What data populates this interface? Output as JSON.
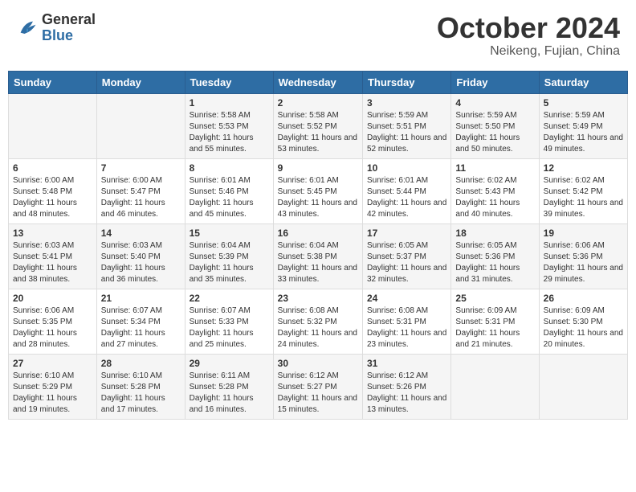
{
  "header": {
    "logo": {
      "general": "General",
      "blue": "Blue"
    },
    "title": "October 2024",
    "location": "Neikeng, Fujian, China"
  },
  "weekdays": [
    "Sunday",
    "Monday",
    "Tuesday",
    "Wednesday",
    "Thursday",
    "Friday",
    "Saturday"
  ],
  "weeks": [
    [
      {
        "day": "",
        "sunrise": "",
        "sunset": "",
        "daylight": ""
      },
      {
        "day": "",
        "sunrise": "",
        "sunset": "",
        "daylight": ""
      },
      {
        "day": "1",
        "sunrise": "Sunrise: 5:58 AM",
        "sunset": "Sunset: 5:53 PM",
        "daylight": "Daylight: 11 hours and 55 minutes."
      },
      {
        "day": "2",
        "sunrise": "Sunrise: 5:58 AM",
        "sunset": "Sunset: 5:52 PM",
        "daylight": "Daylight: 11 hours and 53 minutes."
      },
      {
        "day": "3",
        "sunrise": "Sunrise: 5:59 AM",
        "sunset": "Sunset: 5:51 PM",
        "daylight": "Daylight: 11 hours and 52 minutes."
      },
      {
        "day": "4",
        "sunrise": "Sunrise: 5:59 AM",
        "sunset": "Sunset: 5:50 PM",
        "daylight": "Daylight: 11 hours and 50 minutes."
      },
      {
        "day": "5",
        "sunrise": "Sunrise: 5:59 AM",
        "sunset": "Sunset: 5:49 PM",
        "daylight": "Daylight: 11 hours and 49 minutes."
      }
    ],
    [
      {
        "day": "6",
        "sunrise": "Sunrise: 6:00 AM",
        "sunset": "Sunset: 5:48 PM",
        "daylight": "Daylight: 11 hours and 48 minutes."
      },
      {
        "day": "7",
        "sunrise": "Sunrise: 6:00 AM",
        "sunset": "Sunset: 5:47 PM",
        "daylight": "Daylight: 11 hours and 46 minutes."
      },
      {
        "day": "8",
        "sunrise": "Sunrise: 6:01 AM",
        "sunset": "Sunset: 5:46 PM",
        "daylight": "Daylight: 11 hours and 45 minutes."
      },
      {
        "day": "9",
        "sunrise": "Sunrise: 6:01 AM",
        "sunset": "Sunset: 5:45 PM",
        "daylight": "Daylight: 11 hours and 43 minutes."
      },
      {
        "day": "10",
        "sunrise": "Sunrise: 6:01 AM",
        "sunset": "Sunset: 5:44 PM",
        "daylight": "Daylight: 11 hours and 42 minutes."
      },
      {
        "day": "11",
        "sunrise": "Sunrise: 6:02 AM",
        "sunset": "Sunset: 5:43 PM",
        "daylight": "Daylight: 11 hours and 40 minutes."
      },
      {
        "day": "12",
        "sunrise": "Sunrise: 6:02 AM",
        "sunset": "Sunset: 5:42 PM",
        "daylight": "Daylight: 11 hours and 39 minutes."
      }
    ],
    [
      {
        "day": "13",
        "sunrise": "Sunrise: 6:03 AM",
        "sunset": "Sunset: 5:41 PM",
        "daylight": "Daylight: 11 hours and 38 minutes."
      },
      {
        "day": "14",
        "sunrise": "Sunrise: 6:03 AM",
        "sunset": "Sunset: 5:40 PM",
        "daylight": "Daylight: 11 hours and 36 minutes."
      },
      {
        "day": "15",
        "sunrise": "Sunrise: 6:04 AM",
        "sunset": "Sunset: 5:39 PM",
        "daylight": "Daylight: 11 hours and 35 minutes."
      },
      {
        "day": "16",
        "sunrise": "Sunrise: 6:04 AM",
        "sunset": "Sunset: 5:38 PM",
        "daylight": "Daylight: 11 hours and 33 minutes."
      },
      {
        "day": "17",
        "sunrise": "Sunrise: 6:05 AM",
        "sunset": "Sunset: 5:37 PM",
        "daylight": "Daylight: 11 hours and 32 minutes."
      },
      {
        "day": "18",
        "sunrise": "Sunrise: 6:05 AM",
        "sunset": "Sunset: 5:36 PM",
        "daylight": "Daylight: 11 hours and 31 minutes."
      },
      {
        "day": "19",
        "sunrise": "Sunrise: 6:06 AM",
        "sunset": "Sunset: 5:36 PM",
        "daylight": "Daylight: 11 hours and 29 minutes."
      }
    ],
    [
      {
        "day": "20",
        "sunrise": "Sunrise: 6:06 AM",
        "sunset": "Sunset: 5:35 PM",
        "daylight": "Daylight: 11 hours and 28 minutes."
      },
      {
        "day": "21",
        "sunrise": "Sunrise: 6:07 AM",
        "sunset": "Sunset: 5:34 PM",
        "daylight": "Daylight: 11 hours and 27 minutes."
      },
      {
        "day": "22",
        "sunrise": "Sunrise: 6:07 AM",
        "sunset": "Sunset: 5:33 PM",
        "daylight": "Daylight: 11 hours and 25 minutes."
      },
      {
        "day": "23",
        "sunrise": "Sunrise: 6:08 AM",
        "sunset": "Sunset: 5:32 PM",
        "daylight": "Daylight: 11 hours and 24 minutes."
      },
      {
        "day": "24",
        "sunrise": "Sunrise: 6:08 AM",
        "sunset": "Sunset: 5:31 PM",
        "daylight": "Daylight: 11 hours and 23 minutes."
      },
      {
        "day": "25",
        "sunrise": "Sunrise: 6:09 AM",
        "sunset": "Sunset: 5:31 PM",
        "daylight": "Daylight: 11 hours and 21 minutes."
      },
      {
        "day": "26",
        "sunrise": "Sunrise: 6:09 AM",
        "sunset": "Sunset: 5:30 PM",
        "daylight": "Daylight: 11 hours and 20 minutes."
      }
    ],
    [
      {
        "day": "27",
        "sunrise": "Sunrise: 6:10 AM",
        "sunset": "Sunset: 5:29 PM",
        "daylight": "Daylight: 11 hours and 19 minutes."
      },
      {
        "day": "28",
        "sunrise": "Sunrise: 6:10 AM",
        "sunset": "Sunset: 5:28 PM",
        "daylight": "Daylight: 11 hours and 17 minutes."
      },
      {
        "day": "29",
        "sunrise": "Sunrise: 6:11 AM",
        "sunset": "Sunset: 5:28 PM",
        "daylight": "Daylight: 11 hours and 16 minutes."
      },
      {
        "day": "30",
        "sunrise": "Sunrise: 6:12 AM",
        "sunset": "Sunset: 5:27 PM",
        "daylight": "Daylight: 11 hours and 15 minutes."
      },
      {
        "day": "31",
        "sunrise": "Sunrise: 6:12 AM",
        "sunset": "Sunset: 5:26 PM",
        "daylight": "Daylight: 11 hours and 13 minutes."
      },
      {
        "day": "",
        "sunrise": "",
        "sunset": "",
        "daylight": ""
      },
      {
        "day": "",
        "sunrise": "",
        "sunset": "",
        "daylight": ""
      }
    ]
  ]
}
